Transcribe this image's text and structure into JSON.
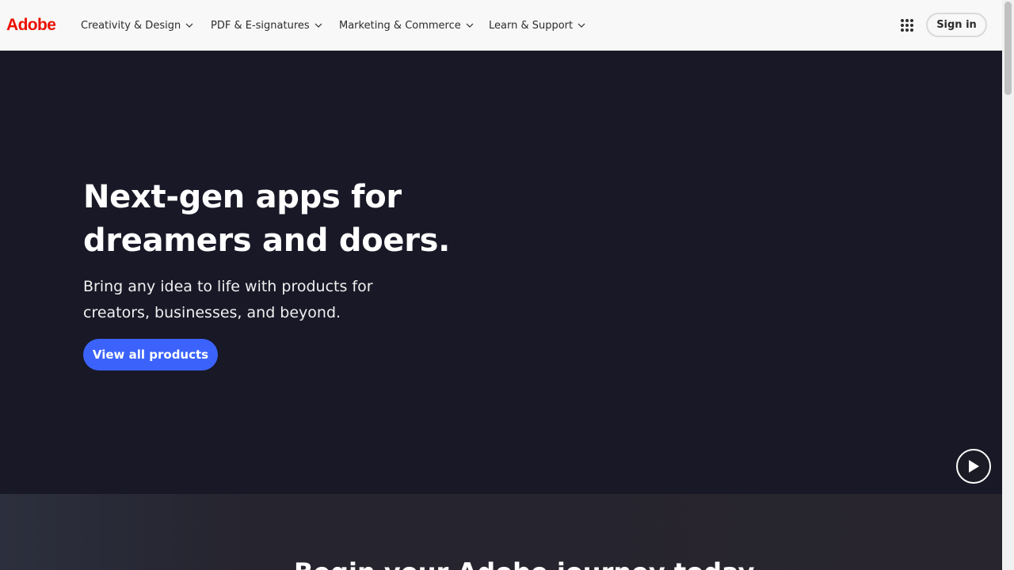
{
  "nav": {
    "logo": "Adobe",
    "items": [
      {
        "label": "Creativity & Design"
      },
      {
        "label": "PDF & E-signatures"
      },
      {
        "label": "Marketing & Commerce"
      },
      {
        "label": "Learn & Support"
      }
    ],
    "apps_icon": "app-grid-icon",
    "signin_label": "Sign in"
  },
  "hero": {
    "title": "Next-gen apps for dreamers and doers.",
    "subtitle": "Bring any idea to life with products for creators, businesses, and beyond.",
    "cta_label": "View all products",
    "play_icon": "play-icon"
  },
  "section2": {
    "title": "Begin your Adobe journey today."
  },
  "colors": {
    "brand_red": "#eb1000",
    "hero_bg": "#181827",
    "cta_blue": "#3b63fb",
    "nav_bg": "#f8f8f8"
  }
}
